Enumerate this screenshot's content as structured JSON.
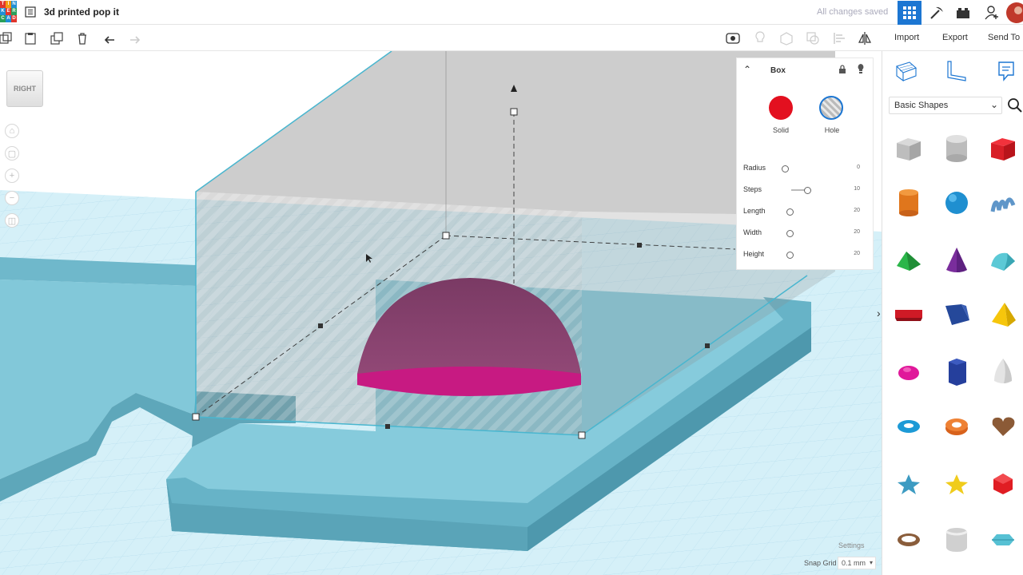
{
  "app": {
    "title": "3d printed pop it",
    "status": "All changes saved",
    "logo_letters": [
      "T",
      "I",
      "N",
      "K",
      "E",
      "R",
      "C",
      "A",
      "D"
    ]
  },
  "toolbar": {
    "import_label": "Import",
    "export_label": "Export",
    "send_to_label": "Send To"
  },
  "viewcube": {
    "label": "RIGHT"
  },
  "inspector": {
    "title": "Box",
    "solid_label": "Solid",
    "hole_label": "Hole",
    "solid_color": "#e3101f",
    "properties": [
      {
        "label": "Radius",
        "value": "0"
      },
      {
        "label": "Steps",
        "value": "10"
      },
      {
        "label": "Length",
        "value": "20"
      },
      {
        "label": "Width",
        "value": "20"
      },
      {
        "label": "Height",
        "value": "20"
      }
    ]
  },
  "library": {
    "selected_category": "Basic Shapes"
  },
  "footer": {
    "settings_label": "Settings",
    "snap_grid_label": "Snap Grid",
    "snap_grid_value": "0.1 mm"
  },
  "colors": {
    "accent": "#1c76d2",
    "workplane": "#cfeef8",
    "tray": "#7fc4d6",
    "dome": "#c71a82"
  }
}
